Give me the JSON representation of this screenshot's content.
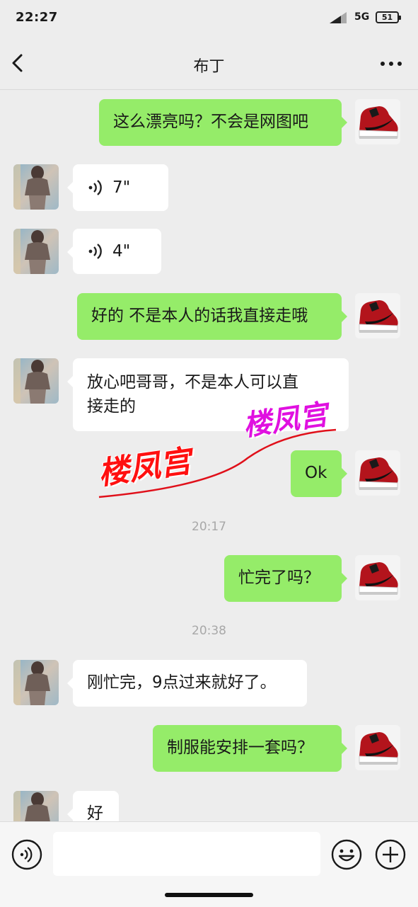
{
  "status": {
    "time": "22:27",
    "network": "5G",
    "battery": "51"
  },
  "nav": {
    "title": "布丁"
  },
  "messages": [
    {
      "type": "sent",
      "text": "这么漂亮吗？不会是网图吧"
    },
    {
      "type": "recv_voice",
      "duration": "7\""
    },
    {
      "type": "recv_voice",
      "duration": "4\""
    },
    {
      "type": "sent",
      "text": "好的 不是本人的话我直接走哦"
    },
    {
      "type": "recv",
      "line1": "放心吧哥哥，不是本人可以直",
      "line2": "接走的"
    },
    {
      "type": "sent",
      "text": "Ok"
    },
    {
      "type": "time",
      "text": "20:17"
    },
    {
      "type": "sent",
      "text": "忙完了吗？"
    },
    {
      "type": "time",
      "text": "20:38"
    },
    {
      "type": "recv",
      "text": "刚忙完，9点过来就好了。"
    },
    {
      "type": "sent",
      "text": "制服能安排一套吗？"
    },
    {
      "type": "recv",
      "text": "好"
    }
  ],
  "watermark": {
    "text_left": "楼凤宫",
    "text_right": "楼凤宫"
  },
  "colors": {
    "sent_bubble": "#95ec69",
    "recv_bubble": "#ffffff",
    "background": "#ededed"
  }
}
